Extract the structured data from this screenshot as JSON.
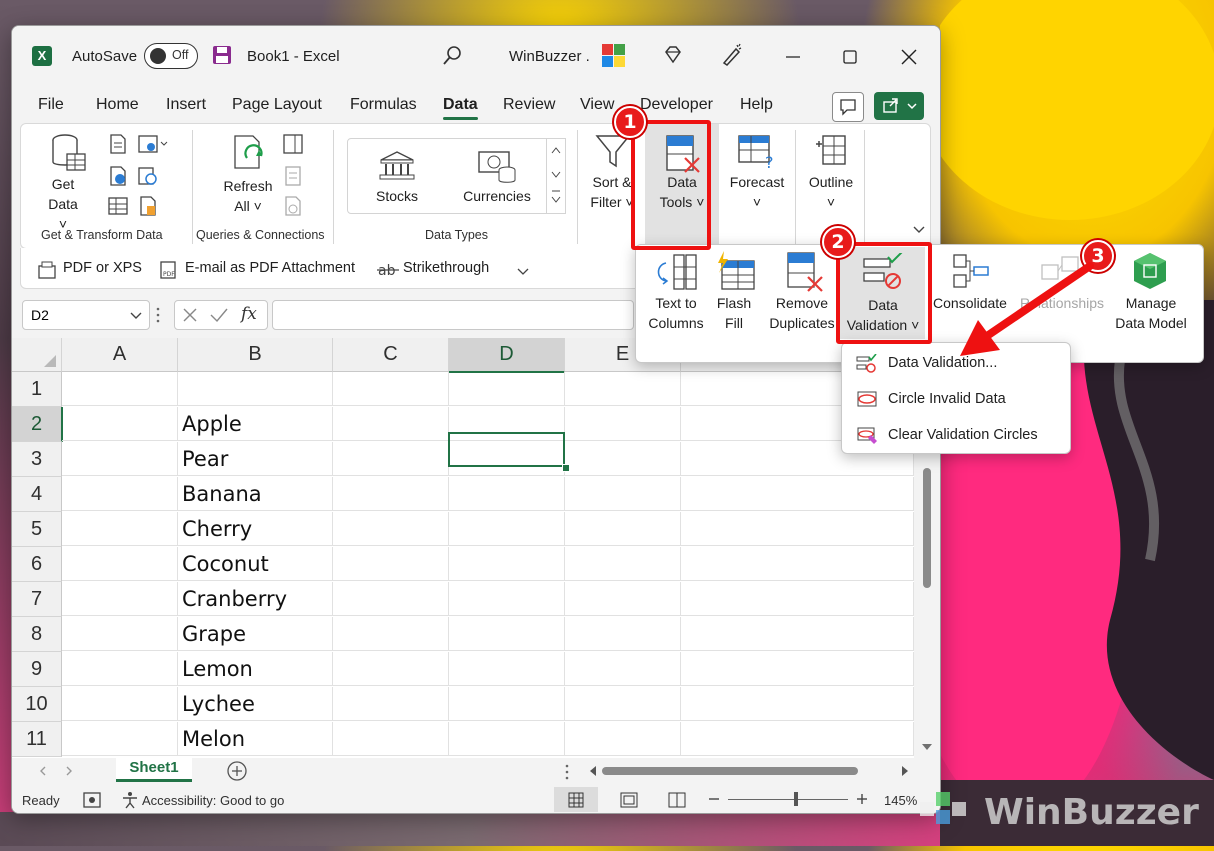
{
  "titlebar": {
    "autosave_label": "AutoSave",
    "autosave_state": "Off",
    "title": "Book1  -  Excel",
    "user": "WinBuzzer ."
  },
  "tabs": [
    "File",
    "Home",
    "Insert",
    "Page Layout",
    "Formulas",
    "Data",
    "Review",
    "View",
    "Developer",
    "Help"
  ],
  "ribbon": {
    "get_data": [
      "Get",
      "Data ˅"
    ],
    "group_get_transform": "Get & Transform Data",
    "refresh_all": [
      "Refresh",
      "All ˅"
    ],
    "group_queries": "Queries & Connections",
    "stocks": "Stocks",
    "currencies": "Currencies",
    "group_data_types": "Data Types",
    "sort_filter": [
      "Sort &",
      "Filter ˅"
    ],
    "data_tools": [
      "Data",
      "Tools ˅"
    ],
    "forecast": [
      "Forecast",
      "˅"
    ],
    "outline": [
      "Outline",
      "˅"
    ]
  },
  "qat": {
    "pdf_xps": "PDF or XPS",
    "email_pdf": "E-mail as PDF Attachment",
    "strikethrough": "Strikethrough"
  },
  "formula_bar": {
    "name_box": "D2",
    "fx": "fx"
  },
  "data_tools_popup": {
    "text_to_columns": [
      "Text to",
      "Columns"
    ],
    "flash_fill": [
      "Flash",
      "Fill"
    ],
    "remove_duplicates": [
      "Remove",
      "Duplicates"
    ],
    "data_validation": [
      "Data",
      "Validation ˅"
    ],
    "consolidate": "Consolidate",
    "relationships": "Relationships",
    "manage_data_model": [
      "Manage",
      "Data Model"
    ]
  },
  "validation_menu": [
    "Data Validation...",
    "Circle Invalid Data",
    "Clear Validation Circles"
  ],
  "grid": {
    "columns": [
      "A",
      "B",
      "C",
      "D",
      "E"
    ],
    "rows": [
      "1",
      "2",
      "3",
      "4",
      "5",
      "6",
      "7",
      "8",
      "9",
      "10",
      "11"
    ],
    "column_b": [
      "",
      "Apple",
      "Pear",
      "Banana",
      "Cherry",
      "Coconut",
      "Cranberry",
      "Grape",
      "Lemon",
      "Lychee",
      "Melon"
    ]
  },
  "sheet": {
    "tab": "Sheet1"
  },
  "status": {
    "ready": "Ready",
    "accessibility": "Accessibility: Good to go",
    "zoom": "145%"
  },
  "badges": [
    "1",
    "2",
    "3"
  ],
  "watermark": "WinBuzzer",
  "colors": {
    "excel_green": "#217346",
    "highlight_red": "#ee1111",
    "badge_red": "#e81b1b"
  }
}
